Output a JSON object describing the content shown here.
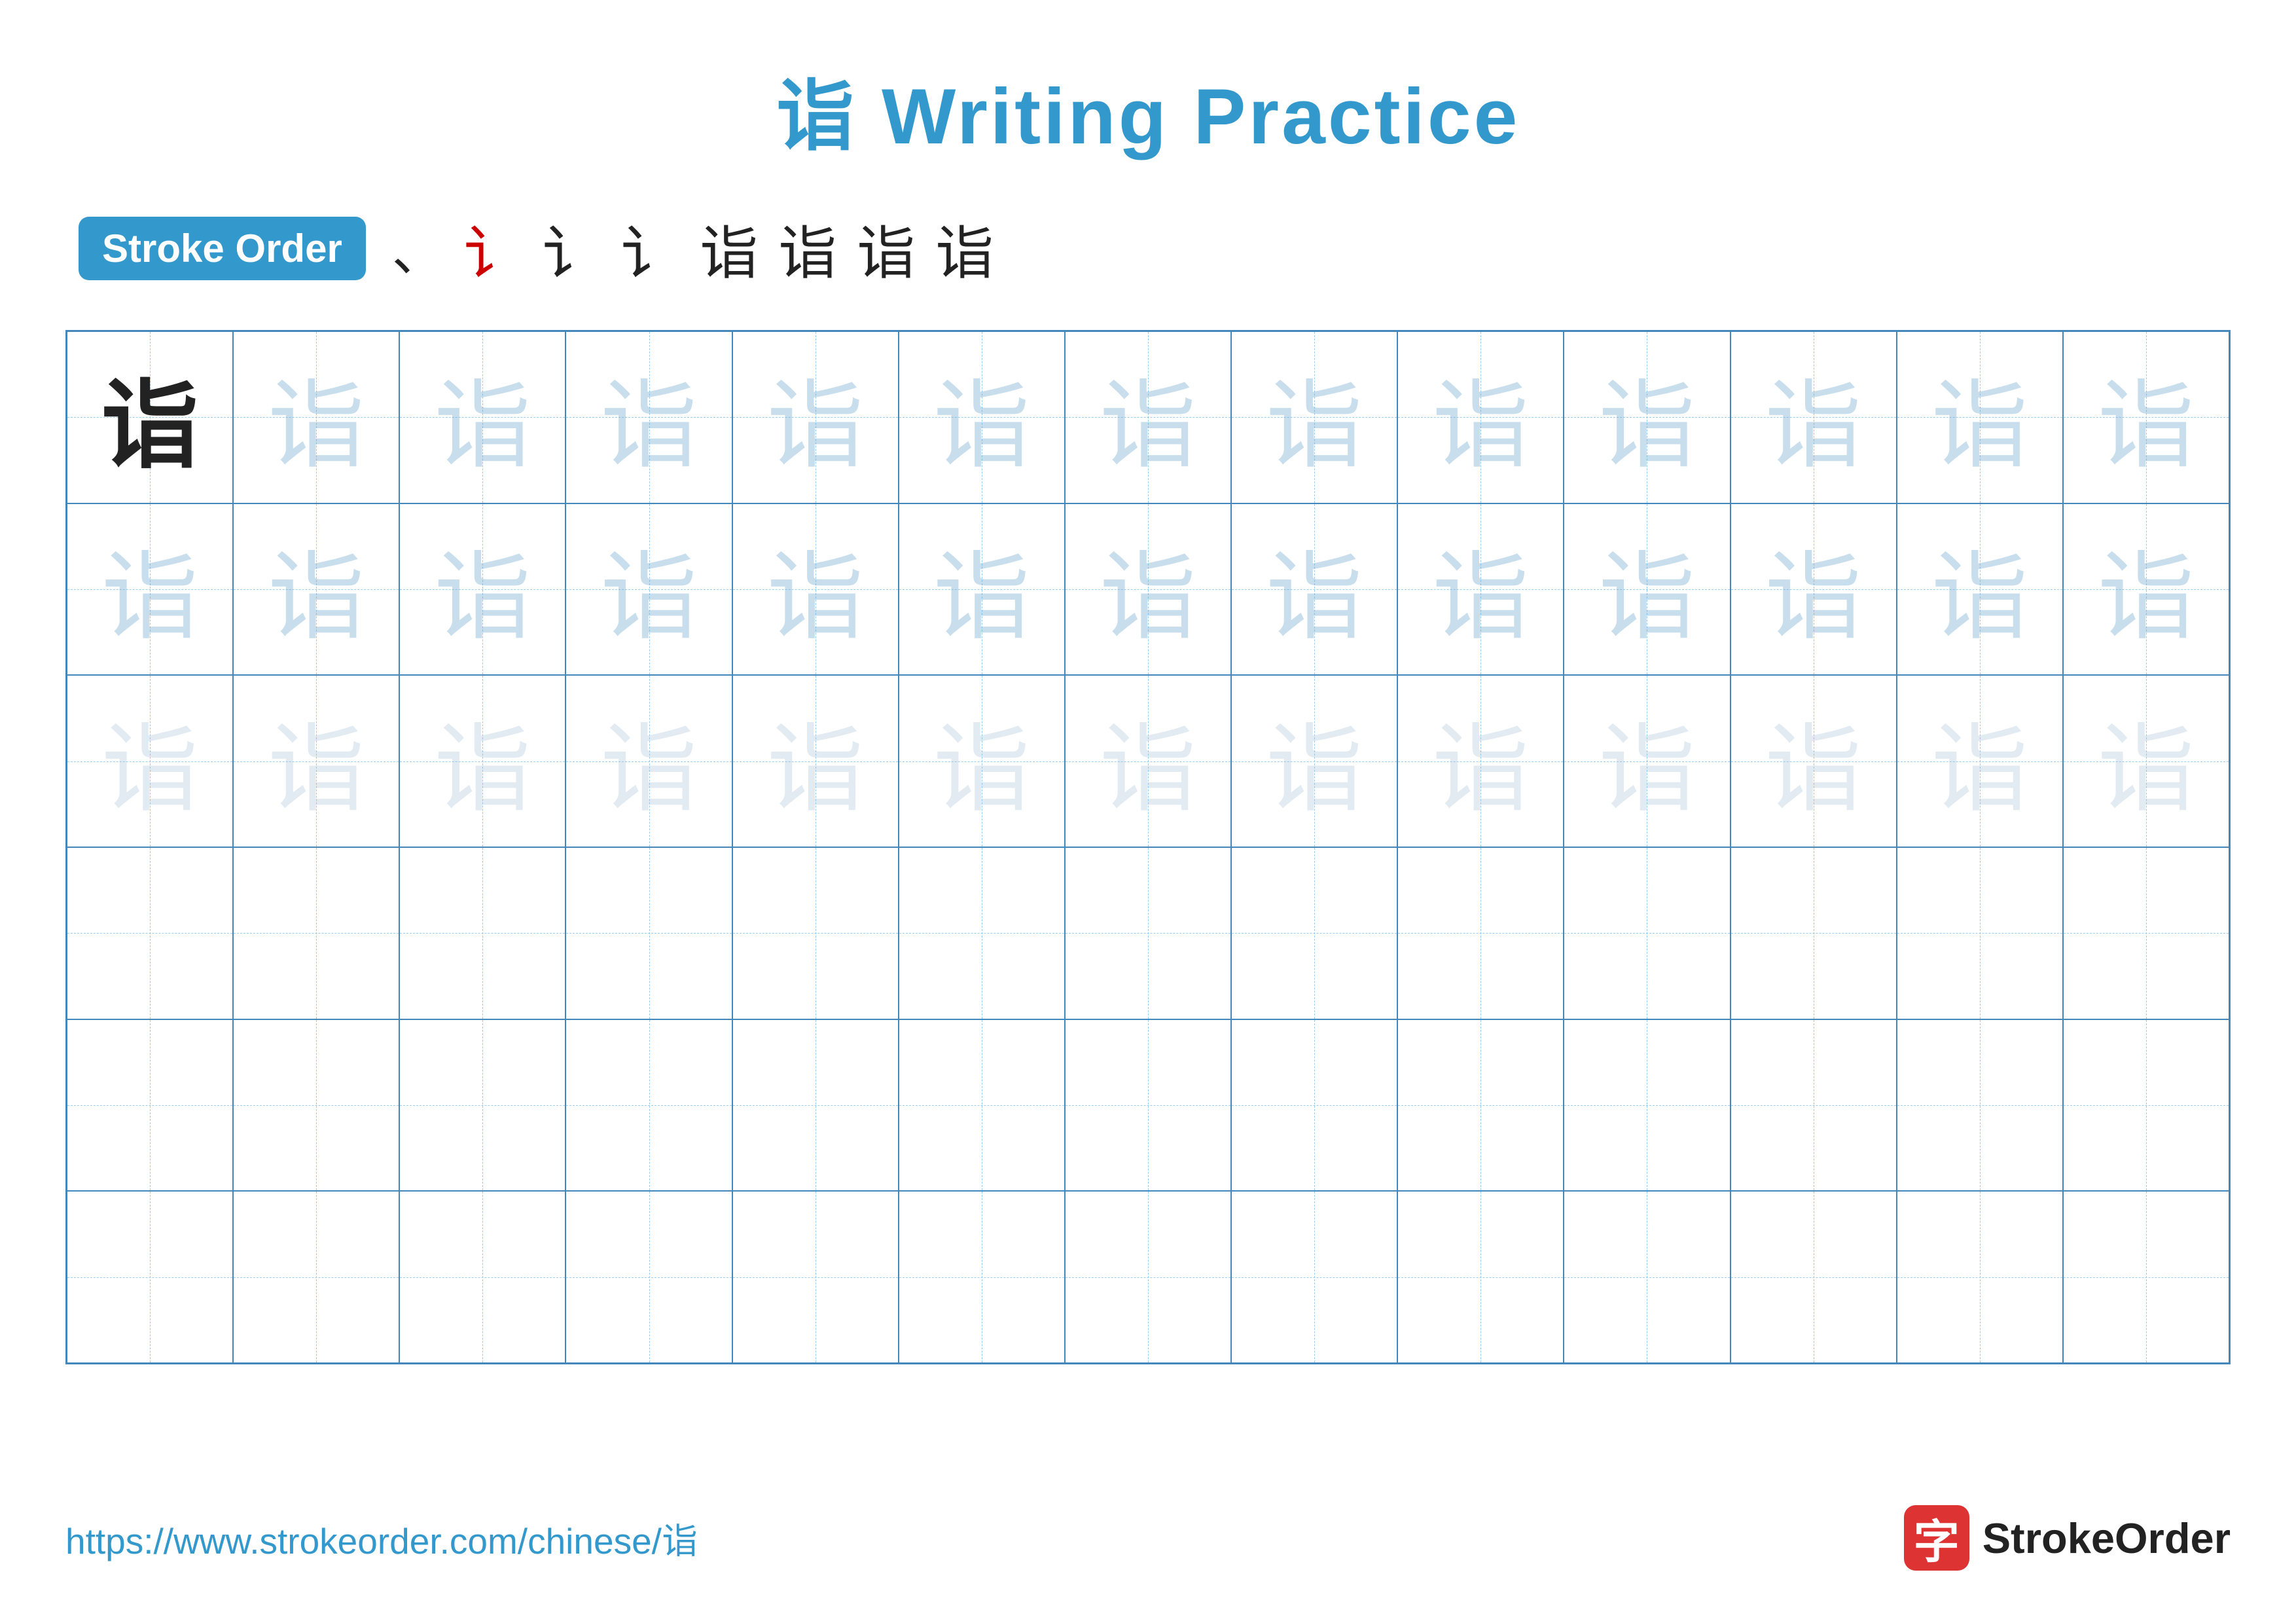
{
  "page": {
    "title": "诣 Writing Practice",
    "background_color": "#ffffff"
  },
  "stroke_order": {
    "badge_label": "Stroke Order",
    "strokes": [
      {
        "char": "、",
        "style": "tick"
      },
      {
        "char": "讠",
        "style": "red"
      },
      {
        "char": "讠",
        "style": "dark"
      },
      {
        "char": "讠",
        "style": "dark"
      },
      {
        "char": "诣",
        "style": "dark"
      },
      {
        "char": "诣",
        "style": "dark"
      },
      {
        "char": "诣",
        "style": "dark"
      },
      {
        "char": "诣",
        "style": "dark"
      }
    ]
  },
  "grid": {
    "cols": 13,
    "rows": 6,
    "character": "诣",
    "row_styles": [
      "solid_then_light1",
      "light1",
      "light2",
      "empty",
      "empty",
      "empty"
    ]
  },
  "footer": {
    "url": "https://www.strokeorder.com/chinese/诣",
    "logo_char": "字",
    "logo_name": "StrokeOrder"
  }
}
